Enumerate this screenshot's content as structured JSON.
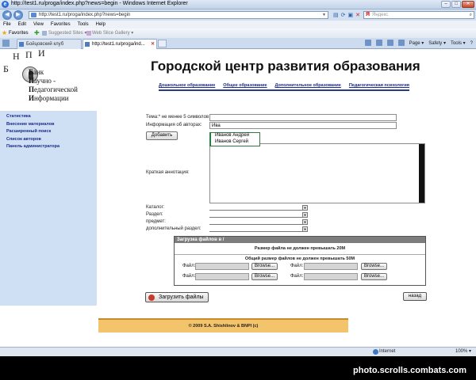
{
  "window": {
    "title": "http://test1.ru/proga/index.php?news=begin - Windows Internet Explorer"
  },
  "address": {
    "url": "http://test1.ru/proga/index.php?news=begin",
    "search_placeholder": "Яндекс"
  },
  "menu": [
    "File",
    "Edit",
    "View",
    "Favorites",
    "Tools",
    "Help"
  ],
  "favorites_bar": {
    "favorites_label": "Favorites",
    "suggested_sites": "Suggested Sites ▾",
    "web_slice_gallery": "Web Slice Gallery ▾"
  },
  "tabs": [
    {
      "label": "Бойцовский клуб",
      "active": false
    },
    {
      "label": "http://test1.ru/proga/ind...",
      "active": true
    }
  ],
  "command_bar": [
    "Page ▾",
    "Safety ▾",
    "Tools ▾",
    "?"
  ],
  "logo": {
    "letters": [
      "Б",
      "Н",
      "П",
      "И"
    ],
    "words": [
      {
        "first": "Б",
        "rest": "анк"
      },
      {
        "first": "Н",
        "rest": "аучно -"
      },
      {
        "first": "П",
        "rest": "едагогической"
      },
      {
        "first": "И",
        "rest": "нформации"
      }
    ]
  },
  "site_title": "Городской центр развития образования",
  "top_nav": [
    "Дошкольное образование",
    "Общее образование",
    "Дополнительное образование",
    "Педагогическая психология"
  ],
  "sidebar": {
    "items": [
      "Статистика",
      "Внесение материалов",
      "Расширенный поиск",
      "Список авторов",
      "Панель администратора"
    ]
  },
  "form": {
    "topic_label": "Тема:* не менее 5 символов",
    "topic_value": "",
    "authors_label": "Информация об авторах:",
    "authors_value": "Ива",
    "add_button": "Добавить",
    "suggestions": [
      "Иванов Андрей",
      "Иванов Сергей"
    ],
    "annotation_label": "Краткая аннотация:",
    "catalog_label": "Каталог:",
    "section_label": "Раздел:",
    "subject_label": "предмет:",
    "extra_section_label": "дополнительный раздел:"
  },
  "upload": {
    "header": "Загрузка файлов в /",
    "limit_single": "Размер файла не должен превышать 20M",
    "limit_total": "Общий размер файлов не должен превышать 50M",
    "file_label": "Файл:",
    "browse_label": "Browse...",
    "submit_label": "Загрузить файлы",
    "back_label": "назад"
  },
  "footer": "© 2009 S.A. Shishlinov & BNPI (c)",
  "status": {
    "zone": "Internet",
    "zoom": "100% ▾"
  },
  "watermark": "photo.scrolls.combats.com"
}
